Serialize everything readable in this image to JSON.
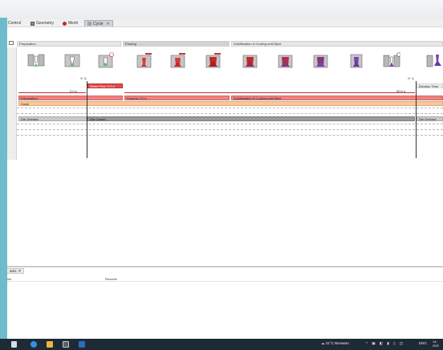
{
  "tabs": [
    {
      "label": "Control",
      "icon": "none"
    },
    {
      "label": "Geometry",
      "icon": "geometry-icon"
    },
    {
      "label": "Mesh",
      "icon": "mesh-icon"
    },
    {
      "label": "Cycle",
      "icon": "cycle-icon",
      "active": true,
      "close": "✕"
    }
  ],
  "stages": {
    "preparation": "Preparation",
    "pouring": "Pouring",
    "solidification": "Solidification & Cooling until Eject"
  },
  "timeline": {
    "t1": "2.0 s",
    "t2": "30.0 s",
    "delay_pour": "Delay Pour: 2.0 s",
    "ejection_time": "Ejection Time",
    "icon_s": "S",
    "icon_p": "P"
  },
  "bars": {
    "preparation": "Preparation",
    "pouring": "Pouring: 2.0 s",
    "solidification": "Solidification & Cooling until Eject",
    "cycle": "Cycle",
    "die_opened_1": "Die Opened",
    "die_closed": "Die Closed",
    "die_opened_2": "Die Opened"
  },
  "panel": {
    "tab": "ams",
    "tab_close": "✕",
    "col1": "ion",
    "col2": "Recurse"
  },
  "taskbar": {
    "weather": "31°C  Berawan",
    "lang": "ENG",
    "time": "14:",
    "date": "20/0"
  },
  "colors": {
    "pour_red": "#d83a3a",
    "cool_purple": "#7a3fb0",
    "taskbar": "#1e2a36"
  }
}
